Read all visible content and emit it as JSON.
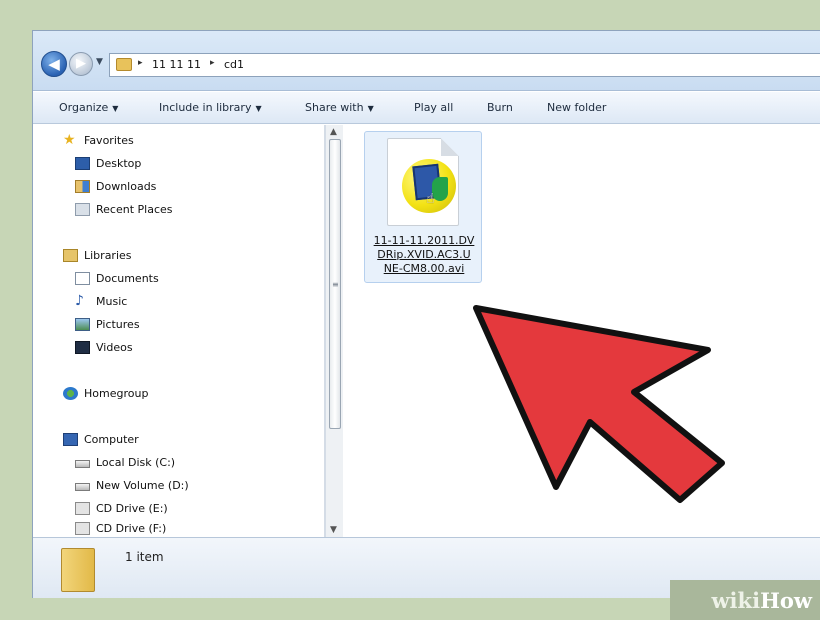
{
  "addressbar": {
    "path": [
      "11 11 11",
      "cd1"
    ],
    "back_glyph": "◀",
    "forward_glyph": "▶",
    "history_glyph": "▼",
    "sep_glyph": "▸"
  },
  "toolbar": {
    "organize": "Organize",
    "include": "Include in library",
    "share": "Share with",
    "play": "Play all",
    "burn": "Burn",
    "new_folder": "New folder",
    "caret": "▼"
  },
  "nav": {
    "favorites": "Favorites",
    "desktop": "Desktop",
    "downloads": "Downloads",
    "recent": "Recent Places",
    "libraries": "Libraries",
    "documents": "Documents",
    "music": "Music",
    "pictures": "Pictures",
    "videos": "Videos",
    "homegroup": "Homegroup",
    "computer": "Computer",
    "local_disk": "Local Disk (C:)",
    "new_volume": "New Volume (D:)",
    "cd_drive": "CD Drive (E:)",
    "cd_drive_partial": "CD Drive (F:)"
  },
  "scrollbar": {
    "up": "▲",
    "down": "▼",
    "grip": "≡"
  },
  "file": {
    "name_lines": [
      "11-11-11.2011.DV",
      "DRip.XVID.AC3.U",
      "NE-CM8.00.avi"
    ]
  },
  "details": {
    "count": "1 item"
  },
  "watermark": {
    "part1": "wiki",
    "part2": "How"
  },
  "colors": {
    "arrow_fill": "#e4393d",
    "arrow_stroke": "#111111",
    "background": "#c7d6b6"
  }
}
